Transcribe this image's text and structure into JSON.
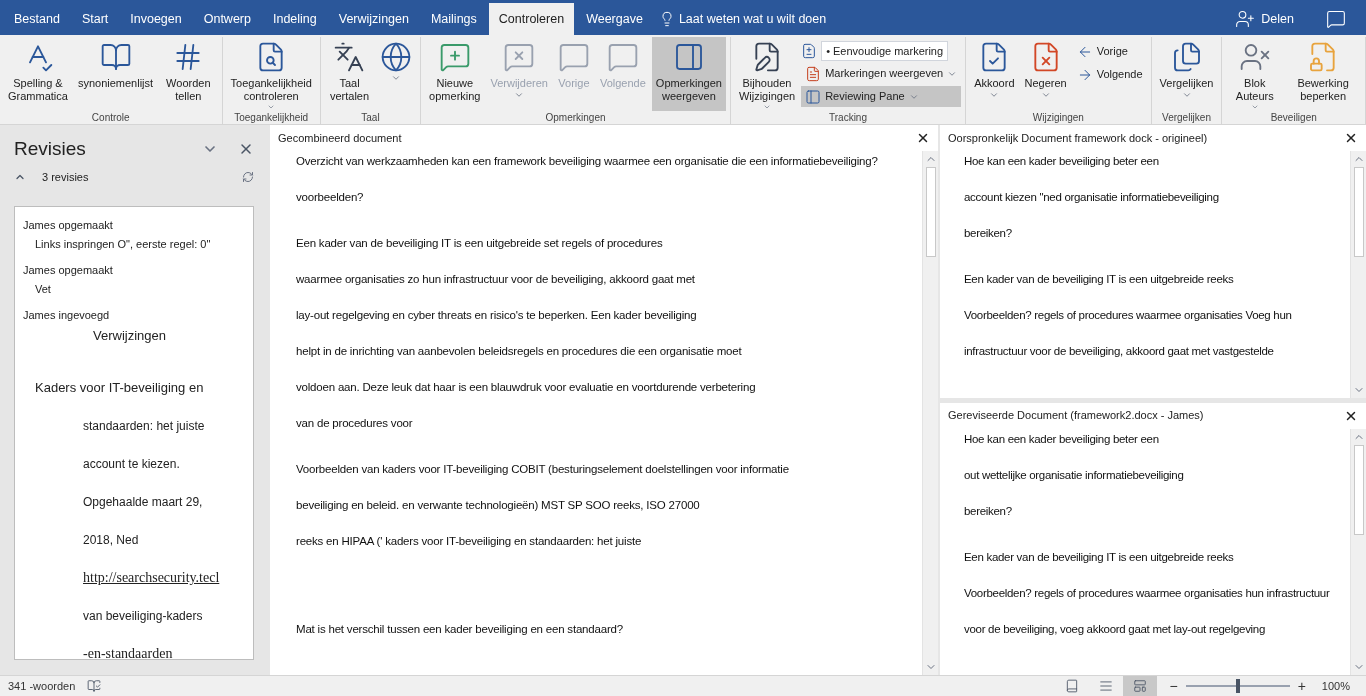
{
  "tabs": [
    {
      "label": "Bestand",
      "selected": false
    },
    {
      "label": "Start",
      "selected": false
    },
    {
      "label": "Invoegen",
      "selected": false
    },
    {
      "label": "Ontwerp",
      "selected": false
    },
    {
      "label": "Indeling",
      "selected": false
    },
    {
      "label": "Verwijzingen",
      "selected": false
    },
    {
      "label": "Mailings",
      "selected": false
    },
    {
      "label": "Controleren",
      "selected": true
    },
    {
      "label": "Weergave",
      "selected": false
    }
  ],
  "tell_me": "Laat weten wat u wilt doen",
  "share": "Delen",
  "ribbon": [
    {
      "name": "Controle",
      "buttons": [
        {
          "kind": "large",
          "label": "Spelling & Grammatica",
          "disabled": false,
          "selected": false,
          "menu": false
        },
        {
          "kind": "large",
          "label": "synoniemenlijst",
          "disabled": false,
          "selected": false,
          "menu": false
        },
        {
          "kind": "large",
          "label": "Woorden tellen",
          "disabled": false,
          "selected": false,
          "menu": false
        }
      ]
    },
    {
      "name": "Toegankelijkheid",
      "buttons": [
        {
          "kind": "large",
          "label": "Toegankelijkheid controleren",
          "disabled": false,
          "selected": false,
          "menu": true
        }
      ]
    },
    {
      "name": "Taal",
      "buttons": [
        {
          "kind": "large",
          "label": "Taal vertalen",
          "disabled": false,
          "selected": false,
          "menu": false
        },
        {
          "kind": "large",
          "disabled": false,
          "selected": false,
          "menu": true
        }
      ]
    },
    {
      "name": "Opmerkingen",
      "buttons": [
        {
          "kind": "large",
          "label": "Nieuwe opmerking",
          "disabled": false,
          "selected": false,
          "menu": false
        },
        {
          "kind": "large",
          "label": "Verwijderen",
          "disabled": true,
          "selected": false,
          "menu": true
        },
        {
          "kind": "large",
          "label": "Vorige",
          "disabled": true,
          "selected": false,
          "menu": false
        },
        {
          "kind": "large",
          "label": "Volgende",
          "disabled": true,
          "selected": false,
          "menu": false
        },
        {
          "kind": "large",
          "label": "Opmerkingen weergeven",
          "disabled": false,
          "selected": true,
          "menu": false
        }
      ]
    },
    {
      "name": "Tracking",
      "buttons": [
        {
          "kind": "large",
          "label": "Bijhouden Wijzigingen",
          "disabled": false,
          "selected": false,
          "menu": true
        },
        {
          "kind": "field",
          "label": "• Eenvoudige markering",
          "disabled": false
        },
        {
          "kind": "small",
          "label": "Markeringen weergeven",
          "disabled": false,
          "selected": false,
          "menu": true
        },
        {
          "kind": "small",
          "label": "Reviewing Pane",
          "disabled": false,
          "selected": true,
          "menu": true
        }
      ]
    },
    {
      "name": "Wijzigingen",
      "buttons": [
        {
          "kind": "large",
          "label": "Akkoord",
          "disabled": false,
          "selected": false,
          "menu": true
        },
        {
          "kind": "large",
          "label": "Negeren",
          "disabled": false,
          "selected": false,
          "menu": true
        },
        {
          "kind": "small",
          "label": "Vorige",
          "disabled": false,
          "selected": false,
          "menu": false
        },
        {
          "kind": "small",
          "label": "Volgende",
          "disabled": false,
          "selected": false,
          "menu": false
        }
      ]
    },
    {
      "name": "Vergelijken",
      "buttons": [
        {
          "kind": "large",
          "label": "Vergelijken",
          "disabled": false,
          "selected": false,
          "menu": true
        }
      ]
    },
    {
      "name": "Beveiligen",
      "buttons": [
        {
          "kind": "large",
          "label": "Blok Auteurs",
          "disabled": false,
          "selected": false,
          "menu": true
        },
        {
          "kind": "large",
          "label": "Bewerking beperken",
          "disabled": false,
          "selected": false,
          "menu": false
        }
      ]
    }
  ],
  "revisions_pane": {
    "title": "Revisies",
    "count": "3 revisies",
    "revisions": [
      {
        "header": "James opgemaakt",
        "detail": "Links inspringen  O\", eerste regel: 0\""
      },
      {
        "header": "James opgemaakt",
        "detail": "Vet"
      },
      {
        "header": "James ingevoegd",
        "detail": "Verwijzingen"
      }
    ],
    "inserted": [
      {
        "kind": "lead",
        "text": "Kaders voor IT-beveiliging en"
      },
      {
        "kind": "indented",
        "text": "standaarden: het juiste"
      },
      {
        "kind": "indented",
        "text": "account te kiezen."
      },
      {
        "kind": "indented",
        "text": "Opgehaalde maart 29,"
      },
      {
        "kind": "indented",
        "text": "2018, Ned"
      },
      {
        "kind": "link",
        "text": "http://searchsecurity.tecl"
      },
      {
        "kind": "indented",
        "text": "van beveiliging-kaders"
      },
      {
        "kind": "link",
        "text": "-en-standaarden"
      }
    ]
  },
  "documents": [
    {
      "title": "Gecombineerd document",
      "paragraphs": [
        [
          "Overzicht van werkzaamheden kan een framework beveiliging waarmee een organisatie die een informatiebeveiliging?",
          "voorbeelden?"
        ],
        [
          "Een kader van de beveiliging IT is een uitgebreide set regels of procedures",
          "waarmee organisaties zo hun infrastructuur voor de beveiliging, akkoord gaat met",
          "lay-out regelgeving en cyber threats en risico's te beperken. Een kader beveiliging",
          "helpt in de inrichting van aanbevolen beleidsregels en procedures die een organisatie moet",
          "voldoen aan. Deze leuk dat haar is een blauwdruk voor evaluatie en voortdurende verbetering",
          "van de procedures voor"
        ],
        [
          "Voorbeelden van kaders voor IT-beveiliging COBIT (besturingselement doelstellingen voor informatie",
          "beveiliging en beleid. en verwante technologieën) MST SP SOO reeks, ISO 27000",
          "reeks en HIPAA (' kaders voor IT-beveiliging en standaarden: het juiste"
        ],
        [
          "Mat is het verschil tussen een kader beveiliging en een standaard?"
        ]
      ]
    },
    {
      "title": "Oorspronkelijk Document framework dock - origineel)",
      "paragraphs": [
        [
          "Hoe kan een kader beveiliging beter een",
          "account kiezen \"ned organisatie informatiebeveiliging",
          "bereiken?"
        ],
        [
          "Een kader van de beveiliging IT is een uitgebreide reeks",
          "Voorbeelden? regels of procedures waarmee organisaties Voeg hun",
          "infrastructuur voor de beveiliging, akkoord gaat met vastgestelde"
        ]
      ]
    },
    {
      "title": "Gereviseerde Document (framework2.docx - James)",
      "paragraphs": [
        [
          "Hoe kan een kader beveiliging beter een",
          "out wettelijke organisatie informatiebeveiliging",
          "bereiken?"
        ],
        [
          "Een kader van de beveiliging IT is een uitgebreide reeks",
          "Voorbeelden? regels of procedures waarmee organisaties hun infrastructuur",
          "voor de beveiliging, voeg akkoord gaat met lay-out regelgeving"
        ]
      ]
    }
  ],
  "status_bar": {
    "words": "341 -woorden",
    "views": [
      {
        "selected": false
      },
      {
        "selected": false
      },
      {
        "selected": true
      }
    ],
    "zoom": {
      "minus": "−",
      "plus": "+",
      "level": 0.5,
      "reading": "100%"
    }
  }
}
